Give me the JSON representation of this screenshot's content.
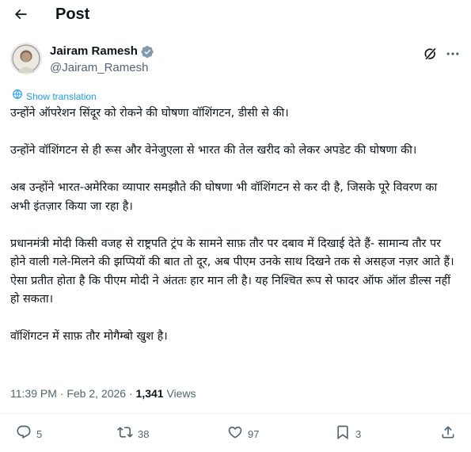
{
  "header": {
    "title": "Post"
  },
  "author": {
    "name": "Jairam Ramesh",
    "handle": "@Jairam_Ramesh"
  },
  "translate_label": "Show translation",
  "post": {
    "paragraphs": [
      "उन्होंने ऑपरेशन सिंदूर को रोकने की घोषणा वॉशिंगटन, डीसी से की।",
      "उन्होंने वॉशिंगटन से ही रूस और वेनेजुएला से भारत की तेल खरीद को लेकर अपडेट की घोषणा की।",
      "अब उन्होंने भारत-अमेरिका व्यापार समझौते की घोषणा भी वॉशिंगटन से कर दी है, जिसके पूरे विवरण का अभी इंतज़ार किया जा रहा है।",
      "प्रधानमंत्री मोदी किसी वजह से राष्ट्रपति ट्रंप के सामने साफ़ तौर पर दबाव में दिखाई देते हैं- सामान्य तौर पर होने वाली गले-मिलने की झप्पियों की बात तो दूर, अब पीएम उनके साथ दिखने तक से असहज नज़र आते हैं। ऐसा प्रतीत होता है कि पीएम मोदी ने अंततः हार मान ली है। यह निश्चित रूप से फादर ऑफ ऑल डील्स नहीं हो सकता।",
      "वॉशिंगटन में साफ़ तौर मोगैम्बो खुश है।"
    ]
  },
  "meta": {
    "time": "11:39 PM",
    "separator": "·",
    "date": "Feb 2, 2026",
    "views_count": "1,341",
    "views_label": "Views"
  },
  "actions": {
    "replies": "5",
    "reposts": "38",
    "likes": "97",
    "bookmarks": "3"
  },
  "colors": {
    "accent": "#1d9bf0",
    "text": "#0f1419",
    "secondary": "#536471"
  }
}
